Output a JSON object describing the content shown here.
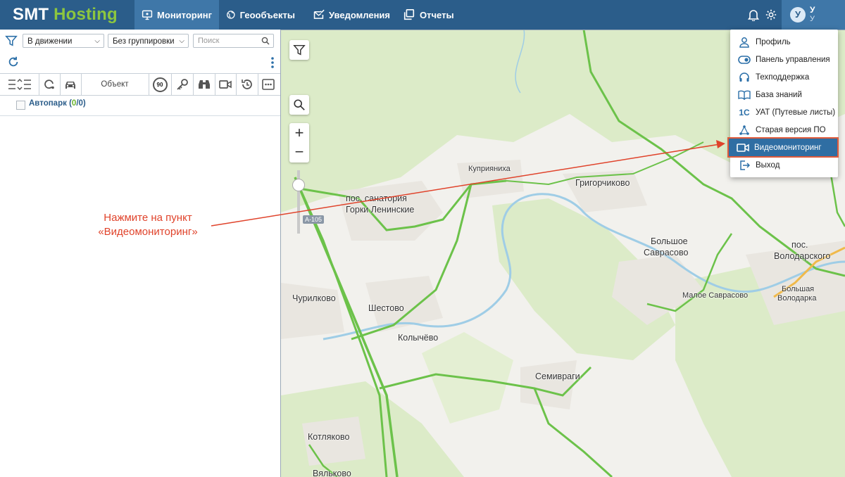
{
  "brand": {
    "part1": "SMT",
    "part2": "Hosting"
  },
  "nav": [
    {
      "label": "Мониторинг",
      "icon": "monitor-icon",
      "active": true
    },
    {
      "label": "Геообъекты",
      "icon": "globe-icon",
      "active": false
    },
    {
      "label": "Уведомления",
      "icon": "mail-check-icon",
      "active": false
    },
    {
      "label": "Отчеты",
      "icon": "reports-icon",
      "active": false
    }
  ],
  "user": {
    "initial": "У",
    "line1": "У",
    "line2": "У"
  },
  "left_panel": {
    "filter_motion": "В движении",
    "filter_group": "Без группировки",
    "search_placeholder": "Поиск",
    "object_header": "Объект",
    "speed_badge": "90",
    "fleet": {
      "label": "Автопарк",
      "open": "(",
      "count_a": "0",
      "slash": "/",
      "count_b": "0",
      "close": ")"
    }
  },
  "map_labels": {
    "kupriyanikha": "Куприяниха",
    "grigorchikovo": "Григорчиково",
    "sanatoriy1": "пос. санатория",
    "sanatoriy2": "Горки Ленинские",
    "road": "А-105",
    "bolshoe1": "Большое",
    "bolshoe2": "Саврасово",
    "maloe": "Малое Саврасово",
    "volod1": "пос.",
    "volod2": "Володарского",
    "bvolod1": "Большая",
    "bvolod2": "Володарка",
    "churilkovo": "Чурилково",
    "shestovo": "Шестово",
    "kolychevo": "Колычёво",
    "semivragi": "Семивраги",
    "kotlyakovo": "Котляково",
    "vyalkovo": "Вяльково"
  },
  "menu": [
    {
      "label": "Профиль",
      "icon": "user-icon"
    },
    {
      "label": "Панель управления",
      "icon": "toggle-icon"
    },
    {
      "label": "Техподдержка",
      "icon": "headset-icon"
    },
    {
      "label": "База знаний",
      "icon": "book-icon"
    },
    {
      "label": "УАТ (Путевые листы)",
      "icon": "1c-icon"
    },
    {
      "label": "Старая версия ПО",
      "icon": "network-icon"
    },
    {
      "label": "Видеомониторинг",
      "icon": "camera-icon",
      "highlighted": true
    },
    {
      "label": "Выход",
      "icon": "logout-icon"
    }
  ],
  "annotation": {
    "line1": "Нажмите на пункт",
    "line2": "«Видеомониторинг»"
  },
  "colors": {
    "topbar": "#2b5d8a",
    "accent": "#8cc63f",
    "highlight_border": "#e05a3a",
    "annotation": "#e0432b"
  }
}
